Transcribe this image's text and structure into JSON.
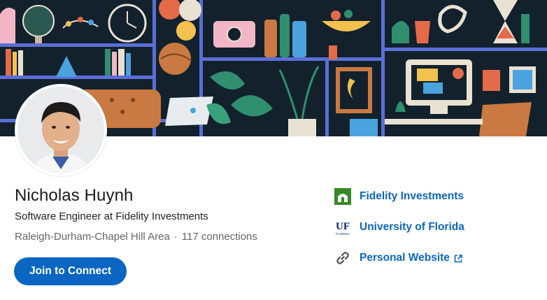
{
  "profile": {
    "name": "Nicholas Huynh",
    "headline": "Software Engineer at Fidelity Investments",
    "location": "Raleigh-Durham-Chapel Hill Area",
    "separator": "·",
    "connections": "117 connections"
  },
  "actions": {
    "join_label": "Join to Connect"
  },
  "links": {
    "company": {
      "label": "Fidelity Investments",
      "icon": "fidelity-logo-icon"
    },
    "school": {
      "label": "University of Florida",
      "icon": "uf-logo-icon",
      "logo_text": "UF",
      "logo_subtext": "FLORIDA"
    },
    "website": {
      "label": "Personal Website",
      "icon": "link-icon"
    }
  },
  "colors": {
    "accent": "#0a66c2",
    "fidelity_green": "#368727",
    "uf_blue": "#0a1f6e"
  }
}
